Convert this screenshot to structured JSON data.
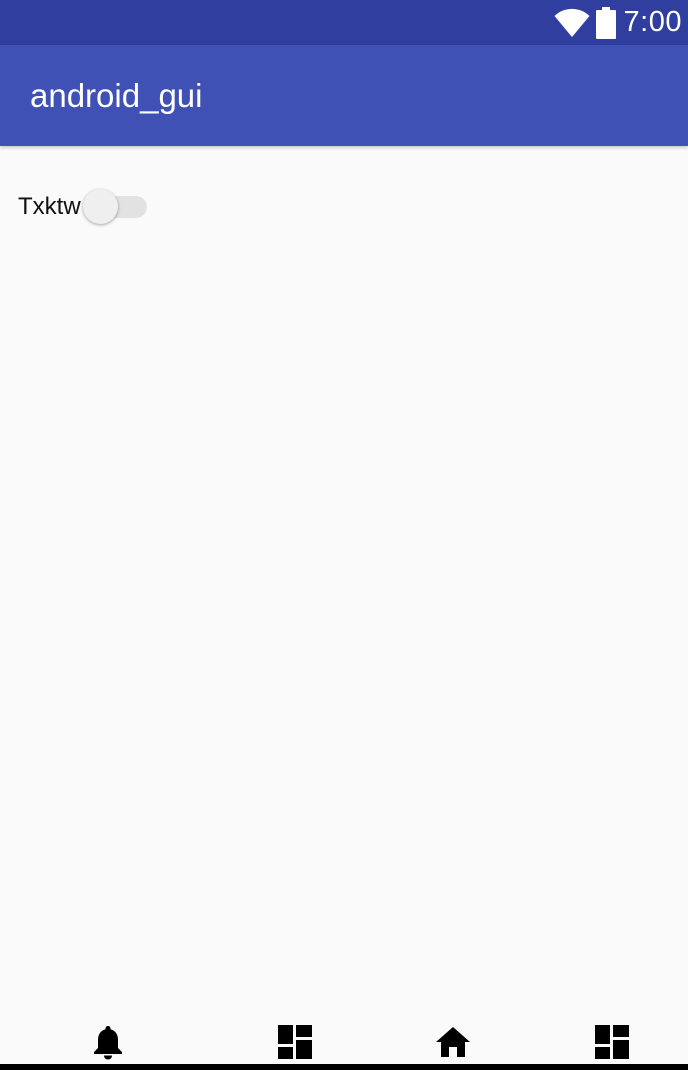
{
  "status_bar": {
    "time": "7:00",
    "icons": [
      "wifi-icon",
      "battery-icon"
    ],
    "color": "#303f9f"
  },
  "app_bar": {
    "title": "android_gui",
    "color": "#3f51b5"
  },
  "content": {
    "switch": {
      "label": "Txktw",
      "checked": false
    }
  },
  "bottom_nav": {
    "items": [
      {
        "icon": "notifications-icon"
      },
      {
        "icon": "dashboard-icon"
      },
      {
        "icon": "home-icon"
      },
      {
        "icon": "dashboard-icon"
      }
    ]
  }
}
